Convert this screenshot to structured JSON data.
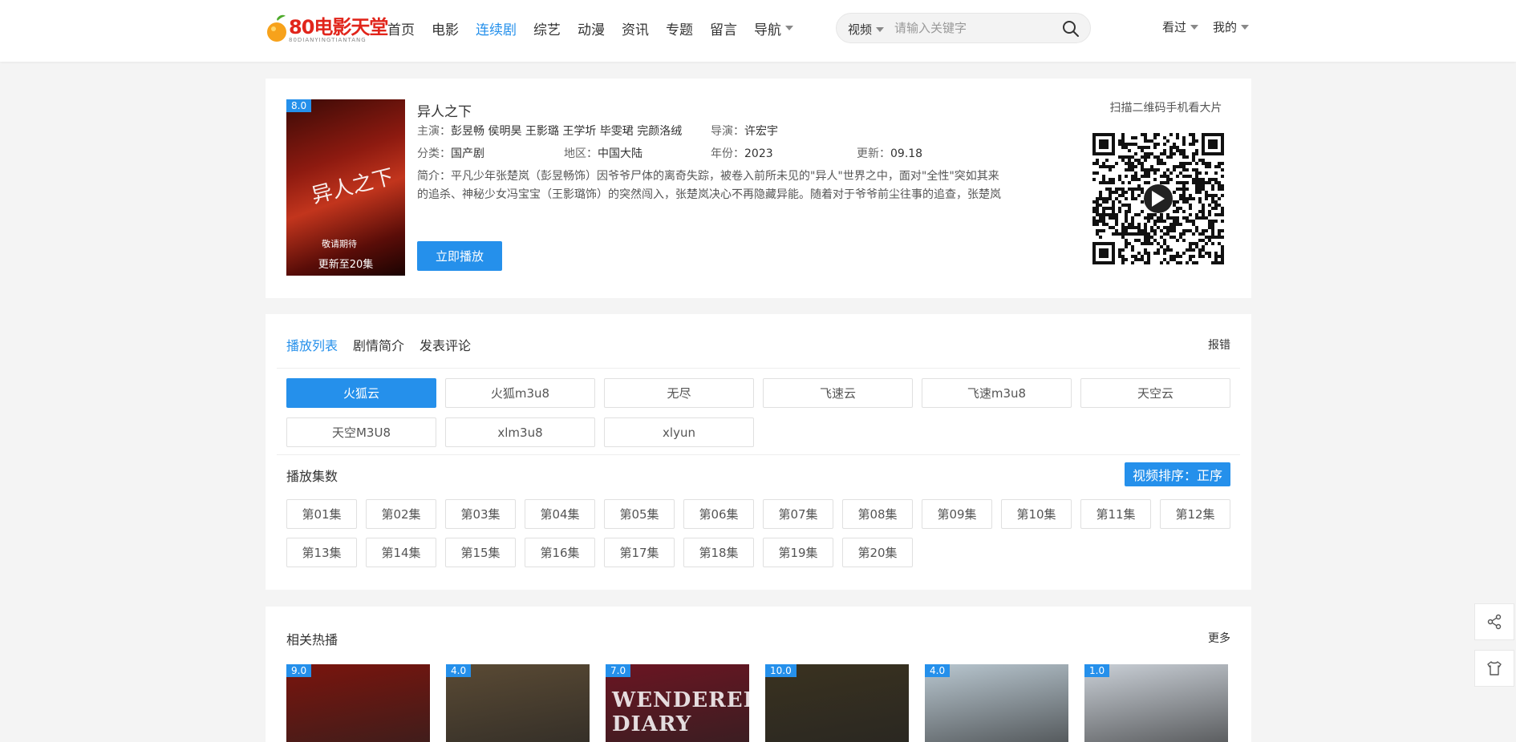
{
  "header": {
    "logo_text": "80电影天堂",
    "logo_sub": "80DIANYINGTIANTANG",
    "nav": [
      {
        "label": "首页",
        "active": false
      },
      {
        "label": "电影",
        "active": false
      },
      {
        "label": "连续剧",
        "active": true
      },
      {
        "label": "综艺",
        "active": false
      },
      {
        "label": "动漫",
        "active": false
      },
      {
        "label": "资讯",
        "active": false
      },
      {
        "label": "专题",
        "active": false
      },
      {
        "label": "留言",
        "active": false
      },
      {
        "label": "导航",
        "active": false,
        "dropdown": true
      }
    ],
    "search": {
      "type": "视频",
      "placeholder": "请输入关键字"
    },
    "history": "看过",
    "mine": "我的"
  },
  "detail": {
    "score": "8.0",
    "poster_note": "更新至20集",
    "poster_tag": "敬请期待",
    "poster_title": "异人之下",
    "title": "异人之下",
    "actors_label": "主演：",
    "actors": "彭昱畅 侯明昊 王影璐 王学圻 毕雯珺 完颜洛绒",
    "director_label": "导演：",
    "director": "许宏宇",
    "category_label": "分类：",
    "category": "国产剧",
    "region_label": "地区：",
    "region": "中国大陆",
    "year_label": "年份：",
    "year": "2023",
    "update_label": "更新：",
    "update": "09.18",
    "desc_label": "简介：",
    "desc": "平凡少年张楚岚（彭昱畅饰）因爷爷尸体的离奇失踪，被卷入前所未见的\"异人\"世界之中，面对\"全性\"突如其来的追杀、神秘少女冯宝宝（王影璐饰）的突然闯入，张楚岚决心不再隐藏异能。随着对于爷爷前尘往事的追查，张楚岚渐渐融入了异人的江湖，而历史的谜团也逐渐浮现，在那背后似乎有个惊天的秘密，而冯宝宝的神…",
    "play_label": "立即播放",
    "qr_title": "扫描二维码手机看大片"
  },
  "playlist": {
    "tabs": [
      {
        "label": "播放列表",
        "active": true
      },
      {
        "label": "剧情简介",
        "active": false
      },
      {
        "label": "发表评论",
        "active": false
      }
    ],
    "report": "报错",
    "sources": [
      {
        "label": "火狐云",
        "active": true
      },
      {
        "label": "火狐m3u8",
        "active": false
      },
      {
        "label": "无尽",
        "active": false
      },
      {
        "label": "飞速云",
        "active": false
      },
      {
        "label": "飞速m3u8",
        "active": false
      },
      {
        "label": "天空云",
        "active": false
      },
      {
        "label": "天空M3U8",
        "active": false
      },
      {
        "label": "xlm3u8",
        "active": false
      },
      {
        "label": "xlyun",
        "active": false
      }
    ],
    "episodes_title": "播放集数",
    "sort_label": "视频排序：正序",
    "episodes": [
      "第01集",
      "第02集",
      "第03集",
      "第04集",
      "第05集",
      "第06集",
      "第07集",
      "第08集",
      "第09集",
      "第10集",
      "第11集",
      "第12集",
      "第13集",
      "第14集",
      "第15集",
      "第16集",
      "第17集",
      "第18集",
      "第19集",
      "第20集"
    ]
  },
  "related": {
    "title": "相关热播",
    "more": "更多",
    "items": [
      {
        "score": "9.0",
        "color": "#7a140d",
        "wm": ""
      },
      {
        "score": "4.0",
        "color": "#5a4a34",
        "wm": ""
      },
      {
        "score": "7.0",
        "color": "#6b1522",
        "wm": "WENDERELLA DIARY"
      },
      {
        "score": "10.0",
        "color": "#3a3220",
        "wm": ""
      },
      {
        "score": "4.0",
        "color": "#b8c6cf",
        "wm": ""
      },
      {
        "score": "1.0",
        "color": "#c9cfd6",
        "wm": ""
      }
    ]
  },
  "colors": {
    "accent": "#2590eb",
    "logo_red": "#e1251b"
  }
}
